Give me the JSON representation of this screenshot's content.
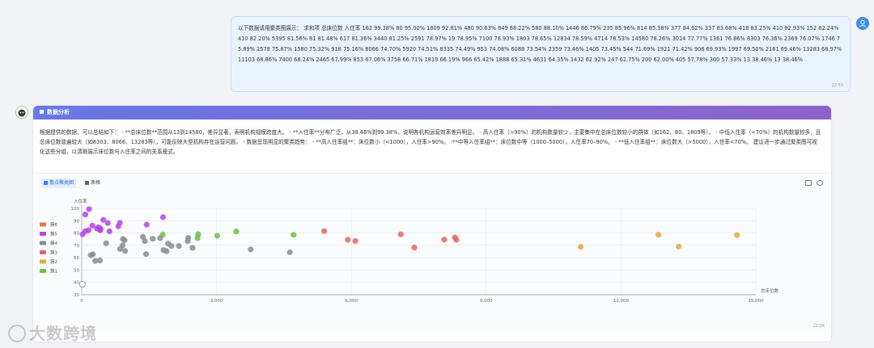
{
  "user_message": {
    "text": "以下数据请用聚类图展示： 求和项 总床位数 入住率 162 99.38% 80 95.00% 1809 92.81% 480 90.63% 849 88.22% 580 88.10% 1446 86.79% 235 85.96% 814 85.38% 377 84.62% 337 83.68% 418 83.25% 410 82.93% 152 82.24% 410 82.20% 5395 81.56% 81 81.48% 617 81.36% 3440 81.25% 2591 78.97% 19 78.95% 7100 78.93% 1803 78.65% 12834 78.59% 4714 78.53% 14580 78.26% 3014 77.77% 1361 76.86% 8303 76.36% 2369 76.07% 1746 75.89% 2578 75.87% 1580 75.32% 918 75.16% 8066 74.70% 5920 74.51% 8335 74.49% 953 74.08% 6088 73.54% 2359 73.46% 1405 73.45% 544 71.69% 1921 71.42% 908 69.93% 1997 69.50% 2161 69.46% 13283 68.97% 11103 68.86% 7400 68.24% 2465 67.99% 853 67.06% 3758 66.71% 1819 66.19% 966 65.42% 1888 65.31% 4631 64.35% 1432 62.92% 247 62.75% 200 62.00% 405 57.78% 300 57.33% 13 38.46% 13 38.46%",
    "time": "22:53",
    "avatar_icon": "user-icon"
  },
  "bot": {
    "avatar_icon": "robot-icon",
    "header_icon": "square-icon",
    "header_title": "数据分析",
    "analysis_text": "根据提供的数据，可以总结如下： - **总床位数**范围从13到14580，差异显著，表明机构规模跨度大。 - **入住率**分布广泛，从38.46%到99.38%，说明各机构运营效率差异明显。 - 高入住率（>90%）的机构数量较少，主要集中在总床位数较小的群体（如162、80、1809等）。 - 中低入住率（<70%）的机构数量较多，且总床位数普遍较大（如8303、8066、13283等），可能反映大型机构存在运营问题。 - 数据呈现明显的聚类趋势： - **高入住率组**：床位数小（<1000），入住率>90%。 -**中等入住率组**：床位数中等（1000–5000），入住率70–90%。 - **低入住率组**：床位数大（>5000），入住率<70%。 建议进一步通过聚类图可视化这些分组，以清晰展示床位数与入住率之间的关系模式。",
    "time": "22:54"
  },
  "tabs": [
    {
      "label": "散点聚类图",
      "active": true,
      "icon": "chart-icon"
    },
    {
      "label": "表格",
      "active": false,
      "icon": "table-icon"
    }
  ],
  "toolbar": {
    "download_icon": "download-icon",
    "comment_icon": "comment-icon"
  },
  "watermark": "大数跨境",
  "chart_data": {
    "type": "scatter",
    "xlabel": "总床位数",
    "ylabel": "入住率",
    "xlim": [
      0,
      15000
    ],
    "ylim": [
      30,
      100
    ],
    "xticks": [
      0,
      3000,
      6000,
      9000,
      12000,
      15000
    ],
    "xtick_labels": [
      "0",
      "3,000",
      "6,000",
      "9,000",
      "12,000",
      "15,000"
    ],
    "yticks": [
      30,
      40,
      50,
      60,
      70,
      80,
      90,
      100
    ],
    "grid": true,
    "legend_position": "left",
    "series": [
      {
        "name": "簇6",
        "color": "#e8743b",
        "points": []
      },
      {
        "name": "簇5",
        "color": "#b545e0",
        "points": [
          [
            162,
            99.38
          ],
          [
            80,
            95.0
          ],
          [
            1809,
            92.81
          ],
          [
            480,
            90.63
          ],
          [
            849,
            88.22
          ],
          [
            580,
            88.1
          ],
          [
            1446,
            86.79
          ],
          [
            235,
            85.96
          ],
          [
            814,
            85.38
          ],
          [
            377,
            84.62
          ],
          [
            337,
            83.68
          ],
          [
            418,
            83.25
          ],
          [
            410,
            82.93
          ],
          [
            152,
            82.24
          ],
          [
            410,
            82.2
          ],
          [
            81,
            81.48
          ],
          [
            617,
            81.36
          ],
          [
            19,
            78.95
          ]
        ]
      },
      {
        "name": "簇4",
        "color": "#8c8c8c",
        "points": [
          [
            1361,
            76.86
          ],
          [
            2369,
            76.07
          ],
          [
            1746,
            75.89
          ],
          [
            1580,
            75.32
          ],
          [
            918,
            75.16
          ],
          [
            953,
            74.08
          ],
          [
            2359,
            73.46
          ],
          [
            1405,
            73.45
          ],
          [
            544,
            71.69
          ],
          [
            1921,
            71.42
          ],
          [
            908,
            69.93
          ],
          [
            1997,
            69.5
          ],
          [
            2161,
            69.46
          ],
          [
            2465,
            67.99
          ],
          [
            853,
            67.06
          ],
          [
            3758,
            66.71
          ],
          [
            1819,
            66.19
          ],
          [
            966,
            65.42
          ],
          [
            1888,
            65.31
          ],
          [
            4631,
            64.35
          ],
          [
            1432,
            62.92
          ],
          [
            247,
            62.75
          ],
          [
            200,
            62.0
          ],
          [
            405,
            57.78
          ],
          [
            300,
            57.33
          ]
        ]
      },
      {
        "name": "簇3",
        "color": "#e06666",
        "points": [
          [
            5395,
            81.56
          ],
          [
            7100,
            78.93
          ],
          [
            8303,
            76.36
          ],
          [
            8066,
            74.7
          ],
          [
            5920,
            74.51
          ],
          [
            8335,
            74.49
          ],
          [
            6088,
            73.54
          ],
          [
            7400,
            68.24
          ]
        ]
      },
      {
        "name": "簇2",
        "color": "#e0a84a",
        "points": [
          [
            12834,
            78.59
          ],
          [
            14580,
            78.26
          ],
          [
            13283,
            68.97
          ],
          [
            11103,
            68.86
          ]
        ]
      },
      {
        "name": "簇1",
        "color": "#6cbf4a",
        "points": [
          [
            3440,
            81.25
          ],
          [
            2591,
            78.97
          ],
          [
            1803,
            78.65
          ],
          [
            4714,
            78.53
          ],
          [
            3014,
            77.77
          ],
          [
            2578,
            75.87
          ]
        ]
      },
      {
        "name": "",
        "color": "#ffffff",
        "points": [
          [
            13,
            38.46
          ]
        ]
      }
    ]
  }
}
